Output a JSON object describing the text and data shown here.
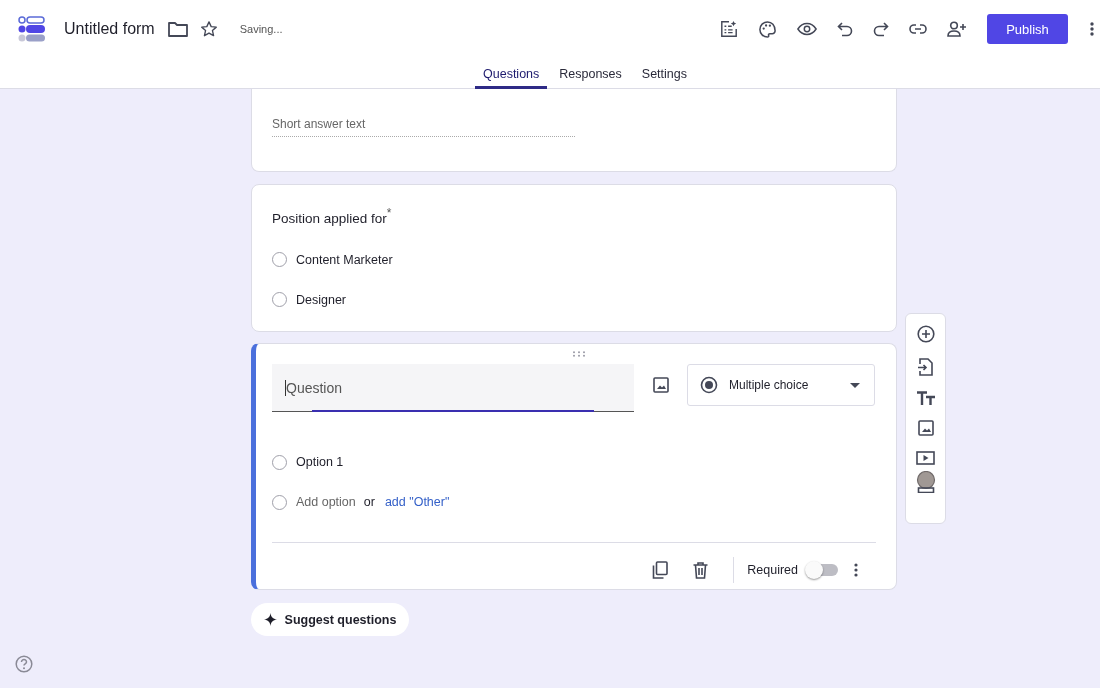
{
  "header": {
    "title": "Untitled form",
    "status": "Saving...",
    "publish": "Publish"
  },
  "tabs": [
    {
      "label": "Questions",
      "selected": true
    },
    {
      "label": "Responses",
      "selected": false
    },
    {
      "label": "Settings",
      "selected": false
    }
  ],
  "short_answer_card": {
    "placeholder": "Short answer text"
  },
  "choice_card": {
    "title": "Position applied for",
    "required_mark": "*",
    "options": [
      {
        "label": "Content Marketer",
        "selected": false
      },
      {
        "label": "Designer",
        "selected": false
      }
    ]
  },
  "edit_card": {
    "question": {
      "placeholder": "Question"
    },
    "type": "Multiple choice",
    "options": [
      {
        "label": "Option 1",
        "selected": false
      }
    ],
    "add_option": {
      "label": "Add option",
      "selected": false
    },
    "or": "or",
    "add_other": "add \"Other\"",
    "required": {
      "label": "Required",
      "on": false
    }
  },
  "suggest_button": "Suggest questions"
}
